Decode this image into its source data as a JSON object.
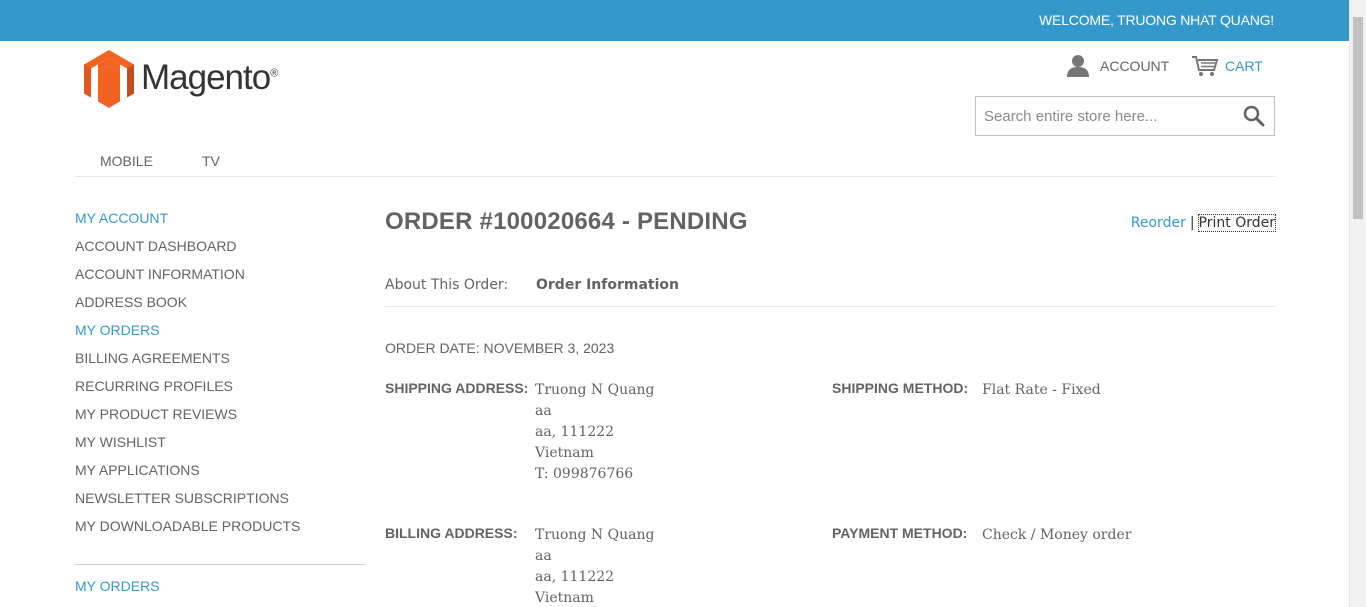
{
  "topbar": {
    "welcome": "WELCOME, TRUONG NHAT QUANG!"
  },
  "logo": {
    "text": "Magento",
    "reg": "®"
  },
  "header": {
    "account_label": "ACCOUNT",
    "cart_label": "CART",
    "search_placeholder": "Search entire store here..."
  },
  "nav": {
    "items": [
      "MOBILE",
      "TV"
    ]
  },
  "sidebar": {
    "title": "MY ACCOUNT",
    "items": [
      "ACCOUNT DASHBOARD",
      "ACCOUNT INFORMATION",
      "ADDRESS BOOK",
      "MY ORDERS",
      "BILLING AGREEMENTS",
      "RECURRING PROFILES",
      "MY PRODUCT REVIEWS",
      "MY WISHLIST",
      "MY APPLICATIONS",
      "NEWSLETTER SUBSCRIPTIONS",
      "MY DOWNLOADABLE PRODUCTS"
    ],
    "active_item": "MY ORDERS",
    "title2": "MY ORDERS"
  },
  "order": {
    "title": "ORDER #100020664 - PENDING",
    "reorder": "Reorder",
    "separator": "|",
    "print": "Print Order",
    "about_label": "About This Order:",
    "about_tab": "Order Information",
    "date": "ORDER DATE: NOVEMBER 3, 2023",
    "shipping_address_label": "SHIPPING ADDRESS:",
    "shipping_address": [
      "Truong N Quang",
      "aa",
      "aa, 111222",
      "Vietnam",
      "T: 099876766"
    ],
    "shipping_method_label": "SHIPPING METHOD:",
    "shipping_method": "Flat Rate - Fixed",
    "billing_address_label": "BILLING ADDRESS:",
    "billing_address": [
      "Truong N Quang",
      "aa",
      "aa, 111222",
      "Vietnam"
    ],
    "payment_method_label": "PAYMENT METHOD:",
    "payment_method": "Check / Money order"
  },
  "colors": {
    "accent": "#3399cc",
    "text": "#636363"
  }
}
